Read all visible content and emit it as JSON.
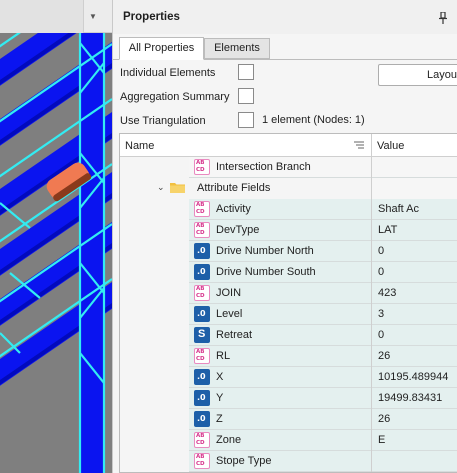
{
  "panel": {
    "title": "Properties",
    "pin_icon": "pin-icon"
  },
  "tabs": [
    {
      "label": "All Properties",
      "active": true
    },
    {
      "label": "Elements",
      "active": false
    }
  ],
  "options": {
    "individual_elements": {
      "label": "Individual Elements",
      "checked": false
    },
    "aggregation_summary": {
      "label": "Aggregation Summary",
      "checked": false
    },
    "use_triangulation": {
      "label": "Use Triangulation",
      "checked": false
    },
    "count_text": "1 element (Nodes: 1)",
    "layout_button": "Layout"
  },
  "grid": {
    "columns": {
      "name": "Name",
      "value": "Value"
    },
    "intersection": {
      "name": "Intersection Branch",
      "type": "text",
      "value": ""
    },
    "folder": {
      "name": "Attribute Fields",
      "expanded": true
    },
    "fields": [
      {
        "name": "Activity",
        "type": "text",
        "value": "Shaft Ac"
      },
      {
        "name": "DevType",
        "type": "text",
        "value": "LAT"
      },
      {
        "name": "Drive Number North",
        "type": "number",
        "value": "0"
      },
      {
        "name": "Drive Number South",
        "type": "number",
        "value": "0"
      },
      {
        "name": "JOIN",
        "type": "text",
        "value": "423"
      },
      {
        "name": "Level",
        "type": "number",
        "value": "3"
      },
      {
        "name": "Retreat",
        "type": "short",
        "value": "0"
      },
      {
        "name": "RL",
        "type": "text",
        "value": "26"
      },
      {
        "name": "X",
        "type": "number",
        "value": "10195.489944"
      },
      {
        "name": "Y",
        "type": "number",
        "value": "19499.83431"
      },
      {
        "name": "Z",
        "type": "number",
        "value": "26"
      },
      {
        "name": "Zone",
        "type": "text",
        "value": "E"
      },
      {
        "name": "Stope Type",
        "type": "text",
        "value": ""
      }
    ]
  },
  "icons": {
    "text_glyph": "AB CD",
    "number_glyph": ".0",
    "short_glyph": "S"
  },
  "colors": {
    "tunnel_blue": "#0a14f0",
    "wireframe_cyan": "#33ecf2",
    "selected_orange": "#f07a52",
    "row_teal": "#e4f0ef"
  }
}
